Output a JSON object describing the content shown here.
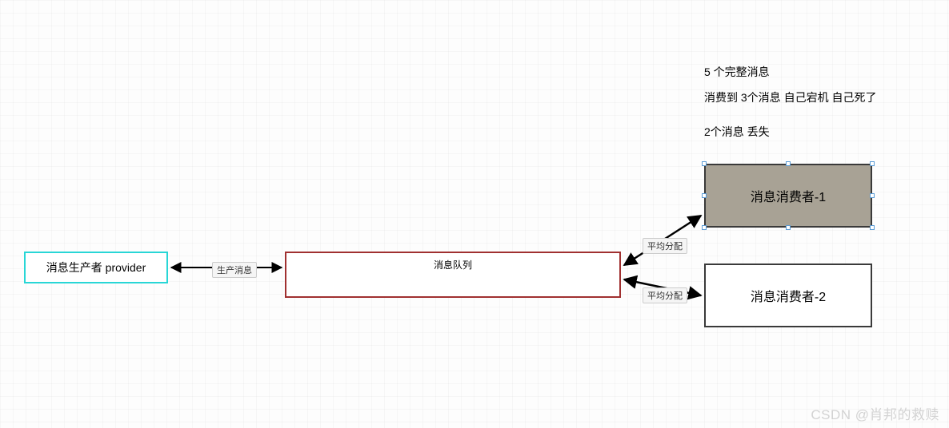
{
  "nodes": {
    "provider": "消息生产者 provider",
    "queue": "消息队列",
    "consumer1": "消息消费者-1",
    "consumer2": "消息消费者-2"
  },
  "edges": {
    "produce": "生产消息",
    "distribute1": "平均分配",
    "distribute2": "平均分配"
  },
  "notes": {
    "line1": "5 个完整消息",
    "line2": "消费到 3个消息   自己宕机 自己死了",
    "line3": "2个消息   丢失"
  },
  "watermark": "CSDN @肖邦的救赎"
}
